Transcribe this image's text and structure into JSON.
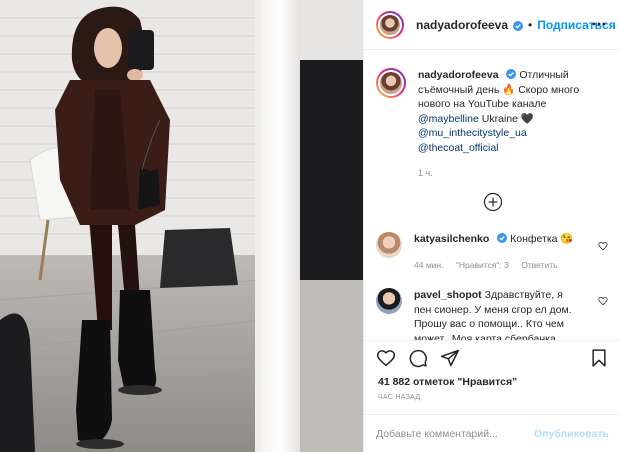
{
  "post": {
    "author": "nadyadorofeeva",
    "follow_label": "Подписаться",
    "separator": "•",
    "caption": {
      "text_1": "Отличный съёмочный день 🔥 Скоро много нового на YouTube канале",
      "mention_1": "@maybelline",
      "text_2": " Ukraine 🖤",
      "mention_2": "@mu_inthecitystyle_ua",
      "mention_3": "@thecoat_official",
      "time": "1 ч."
    },
    "comments": [
      {
        "author": "katyasilchenko",
        "text": "Конфетка 😘",
        "time": "44 мин.",
        "likes": "\"Нравится\": 3",
        "reply": "Ответить"
      },
      {
        "author": "pavel_shopot",
        "text": "Здравствуйте, я пен сионер. У меня сгор ел дом. Прошу вас о помощи.. Кто чем может.. Моя карта сбербанка..."
      }
    ],
    "likes_count": "41 882 отметок \"Нравится\"",
    "posted_ago": "ЧАС НАЗАД",
    "comment_placeholder": "Добавьте комментарий...",
    "publish_label": "Опубликовать"
  },
  "icons": {
    "verified": "verified-badge-icon",
    "more": "more-options-icon",
    "add": "add-comments-icon",
    "like": "heart-icon",
    "comment": "comment-icon",
    "share": "send-icon",
    "save": "bookmark-icon"
  },
  "colors": {
    "accent": "#0095f6",
    "mention": "#00376b",
    "muted": "#8e8e8e",
    "publish_disabled": "#b2dffc"
  }
}
